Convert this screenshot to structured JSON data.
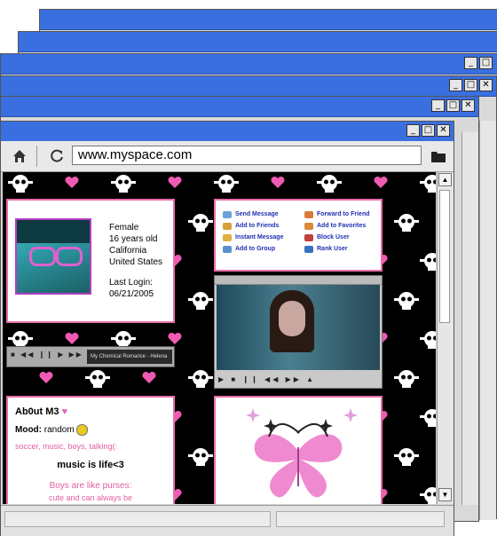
{
  "browser": {
    "url": "www.myspace.com",
    "window_controls": {
      "minimize": "_",
      "maximize": "□",
      "close": "✕"
    }
  },
  "profile": {
    "details": [
      "Female",
      "16 years old",
      "California",
      "United States"
    ],
    "last_login_label": "Last Login:",
    "last_login_date": "06/21/2005"
  },
  "contact": {
    "links": [
      {
        "label": "Send Message",
        "icon": "envelope-icon",
        "color": "#6aa3d8"
      },
      {
        "label": "Forward to Friend",
        "icon": "forward-icon",
        "color": "#d87a3a"
      },
      {
        "label": "Add to Friends",
        "icon": "add-friend-icon",
        "color": "#d8a03a"
      },
      {
        "label": "Add to Favorites",
        "icon": "star-icon",
        "color": "#d88a3a"
      },
      {
        "label": "Instant Message",
        "icon": "chat-icon",
        "color": "#e0b040"
      },
      {
        "label": "Block User",
        "icon": "block-icon",
        "color": "#c04040"
      },
      {
        "label": "Add to Group",
        "icon": "group-icon",
        "color": "#5a8fd0"
      },
      {
        "label": "Rank User",
        "icon": "rank-icon",
        "color": "#3a70c0"
      }
    ]
  },
  "music_player": {
    "track": "My Chemical Romance - Helena"
  },
  "about": {
    "heading": "Ab0ut M3",
    "mood_label": "Mood:",
    "mood_value": "random",
    "interests": "soccer, music, boys, talking(:",
    "motto": "music is life<3",
    "quote_line1": "Boys are like purses:",
    "quote_line2": "cute and can always be"
  },
  "colors": {
    "accent_pink": "#e86ea8",
    "link_blue": "#2030b0",
    "title_blue": "#3a6fe0"
  }
}
